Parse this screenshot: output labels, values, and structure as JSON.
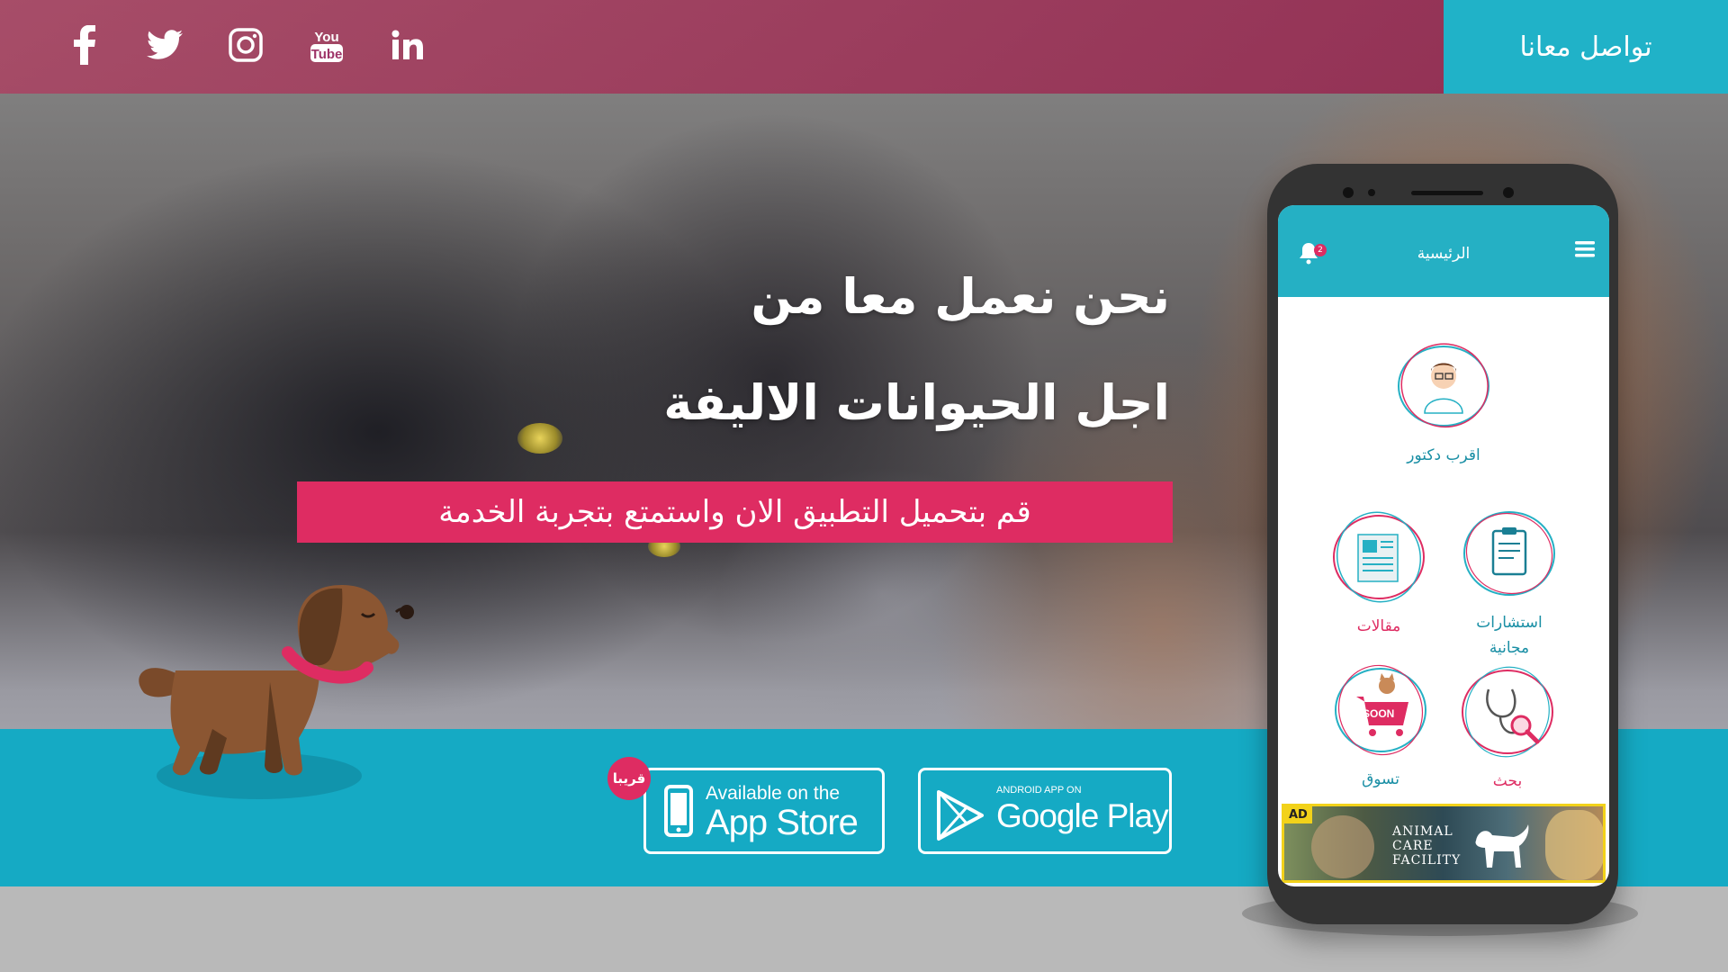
{
  "header": {
    "contact_label": "تواصل معانا",
    "social_icons": [
      "facebook-icon",
      "twitter-icon",
      "instagram-icon",
      "youtube-icon",
      "linkedin-icon"
    ]
  },
  "hero": {
    "title_line1": "نحن نعمل معا من",
    "title_line2": "اجل الحيوانات الاليفة",
    "subtitle": "قم بتحميل التطبيق الان واستمتع بتجربة الخدمة"
  },
  "stores": {
    "soon_badge": "قريبا",
    "app_store_small": "Available on the",
    "app_store_big": "App Store",
    "google_small": "ANDROID APP ON",
    "google_big": "Google Play"
  },
  "phone_app": {
    "title": "الرئيسية",
    "notification_count": "2",
    "features": {
      "doctor": "اقرب دكتور",
      "articles": "مقالات",
      "consult_line1": "استشارات",
      "consult_line2": "مجانية",
      "shop": "تسوق",
      "shop_badge": "SOON",
      "search": "بحث"
    },
    "ad": {
      "tag": "AD",
      "text": "ANIMAL\nCARE\nFACILITY"
    }
  },
  "colors": {
    "accent_teal": "#20b2c8",
    "accent_pink": "#de2c62",
    "topbar": "#9e3468"
  }
}
